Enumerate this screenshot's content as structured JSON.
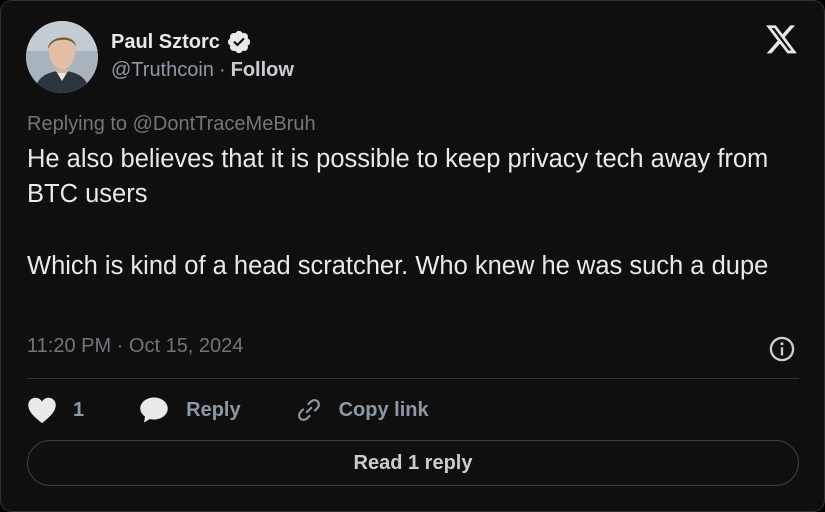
{
  "author": {
    "name": "Paul Sztorc",
    "handle": "@Truthcoin",
    "separator": "·",
    "follow_label": "Follow",
    "verified": true
  },
  "tweet": {
    "replying_to": "Replying to @DontTraceMeBruh",
    "paragraphs": [
      "He also believes that it is possible to keep privacy tech away from BTC users",
      "Which is kind of a head scratcher. Who knew he was such a dupe"
    ],
    "timestamp": "11:20 PM · Oct 15, 2024"
  },
  "actions": {
    "like_count": "1",
    "reply_label": "Reply",
    "copy_label": "Copy link"
  },
  "read_replies_label": "Read 1 reply",
  "icons": {
    "logo": "x-logo-icon",
    "verified": "verified-badge-icon",
    "info": "info-icon",
    "like": "heart-icon",
    "reply": "speech-bubble-icon",
    "copy": "link-icon"
  },
  "colors": {
    "background": "#0f0f10",
    "text_primary": "#e7e9ea",
    "text_secondary": "#71767b",
    "border": "#2f3336"
  }
}
